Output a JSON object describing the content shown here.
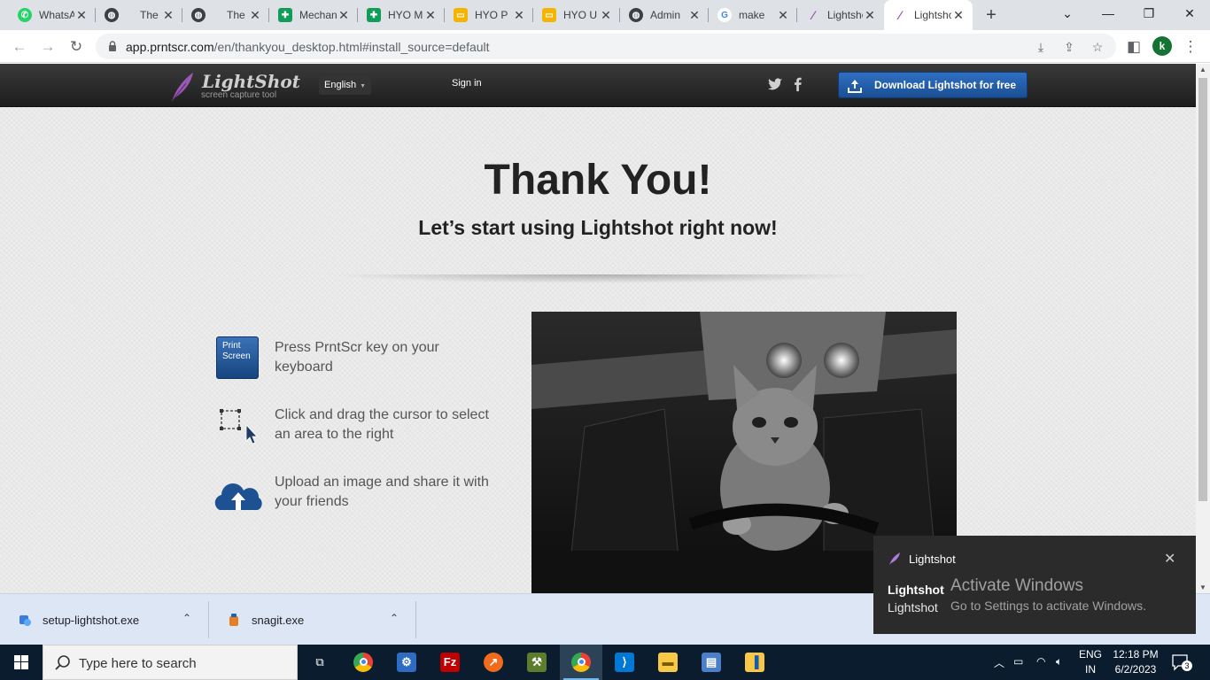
{
  "browser": {
    "tabs": [
      {
        "title": "WhatsApp",
        "icon": "whatsapp-icon",
        "active": false
      },
      {
        "title": "The",
        "icon": "globe-icon",
        "active": false
      },
      {
        "title": "The",
        "icon": "globe-icon",
        "active": false
      },
      {
        "title": "Mechanical",
        "icon": "google-sheets-icon",
        "active": false
      },
      {
        "title": "HYO M",
        "icon": "google-sheets-icon",
        "active": false
      },
      {
        "title": "HYO P",
        "icon": "google-slides-icon",
        "active": false
      },
      {
        "title": "HYO U",
        "icon": "google-slides-icon",
        "active": false
      },
      {
        "title": "Admin",
        "icon": "globe-icon",
        "active": false
      },
      {
        "title": "make",
        "icon": "google-icon",
        "active": false
      },
      {
        "title": "Lightshot",
        "icon": "lightshot-feather-icon",
        "active": false
      },
      {
        "title": "Lightshot",
        "icon": "lightshot-feather-icon",
        "active": true
      }
    ],
    "url_host": "app.prntscr.com",
    "url_path": "/en/thankyou_desktop.html#install_source=default",
    "profile_initial": "k"
  },
  "site": {
    "logo_name": "LightShot",
    "logo_tagline": "screen capture tool",
    "language": "English",
    "signin": "Sign in",
    "download_button": "Download Lightshot for free",
    "title": "Thank You!",
    "subtitle": "Let’s start using Lightshot right now!",
    "key_label_1": "Print",
    "key_label_2": "Screen",
    "steps": [
      {
        "text": "Press PrntScr key on your keyboard"
      },
      {
        "text": "Click and drag the cursor to select an area to the right"
      },
      {
        "text": "Upload an image and share it with your friends"
      }
    ]
  },
  "downloads": [
    {
      "name": "setup-lightshot.exe"
    },
    {
      "name": "snagit.exe"
    }
  ],
  "toast": {
    "app": "Lightshot",
    "line1": "Lightshot",
    "line2": "Lightshot"
  },
  "watermark": {
    "line1": "Activate Windows",
    "line2": "Go to Settings to activate Windows."
  },
  "taskbar": {
    "search_placeholder": "Type here to search",
    "language_1": "ENG",
    "language_2": "IN",
    "time": "12:18 PM",
    "date": "6/2/2023",
    "notification_count": "3"
  },
  "colors": {
    "download_button": "#2463b3",
    "header": "#2a2a2a",
    "taskbar": "#0a1c2e",
    "downloads_bar": "#dde6f4"
  }
}
